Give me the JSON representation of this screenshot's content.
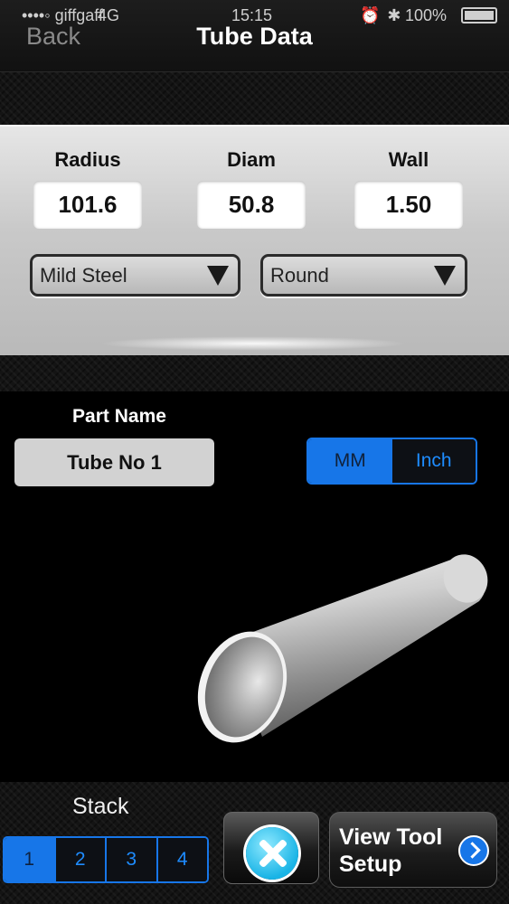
{
  "status_bar": {
    "carrier": "••••◦ giffgaff",
    "network": "4G",
    "time": "15:15",
    "battery": "100%"
  },
  "nav": {
    "back_label": "Back",
    "title": "Tube Data"
  },
  "dimensions": {
    "radius_label": "Radius",
    "radius_value": "101.6",
    "diam_label": "Diam",
    "diam_value": "50.8",
    "wall_label": "Wall",
    "wall_value": "1.50"
  },
  "selects": {
    "material": "Mild Steel",
    "shape": "Round"
  },
  "part": {
    "label": "Part Name",
    "value": "Tube No 1"
  },
  "units": {
    "options": [
      "MM",
      "Inch"
    ],
    "selected": "MM"
  },
  "stack": {
    "label": "Stack",
    "options": [
      "1",
      "2",
      "3",
      "4"
    ],
    "selected": "1"
  },
  "buttons": {
    "view_tool_setup": "View Tool Setup"
  },
  "colors": {
    "accent": "#1776e8",
    "clear_icon": "#19b4e6"
  }
}
